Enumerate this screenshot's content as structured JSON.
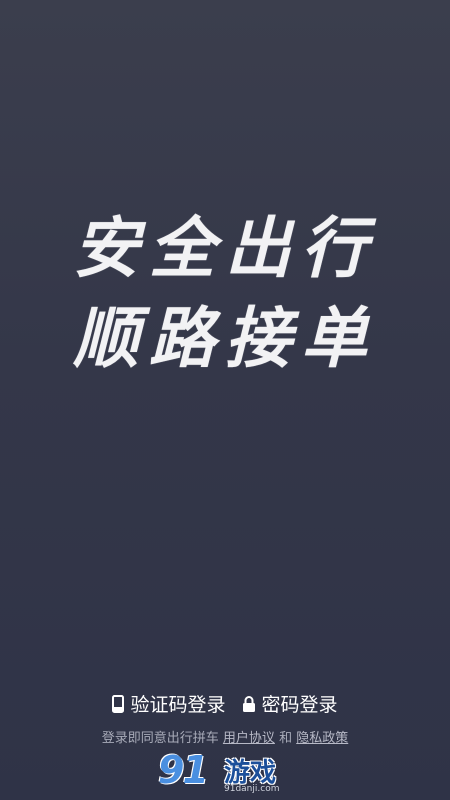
{
  "slogan": {
    "line1": "安全出行",
    "line2": "顺路接单"
  },
  "login": {
    "sms_label": "验证码登录",
    "sms_icon": "phone-icon",
    "password_label": "密码登录",
    "password_icon": "lock-icon"
  },
  "agreement": {
    "prefix": "登录即同意出行拼车",
    "user_agreement": "用户协议",
    "conjunction": "和",
    "privacy_policy": "隐私政策"
  },
  "watermark": {
    "logo": "91",
    "text": "游戏",
    "url": "91danji.com"
  },
  "colors": {
    "background_top": "#3b3e4d",
    "background_bottom": "#2f3347",
    "text_primary": "#ffffff",
    "text_secondary": "#a8abb8",
    "watermark_blue": "#4a8fe0"
  }
}
